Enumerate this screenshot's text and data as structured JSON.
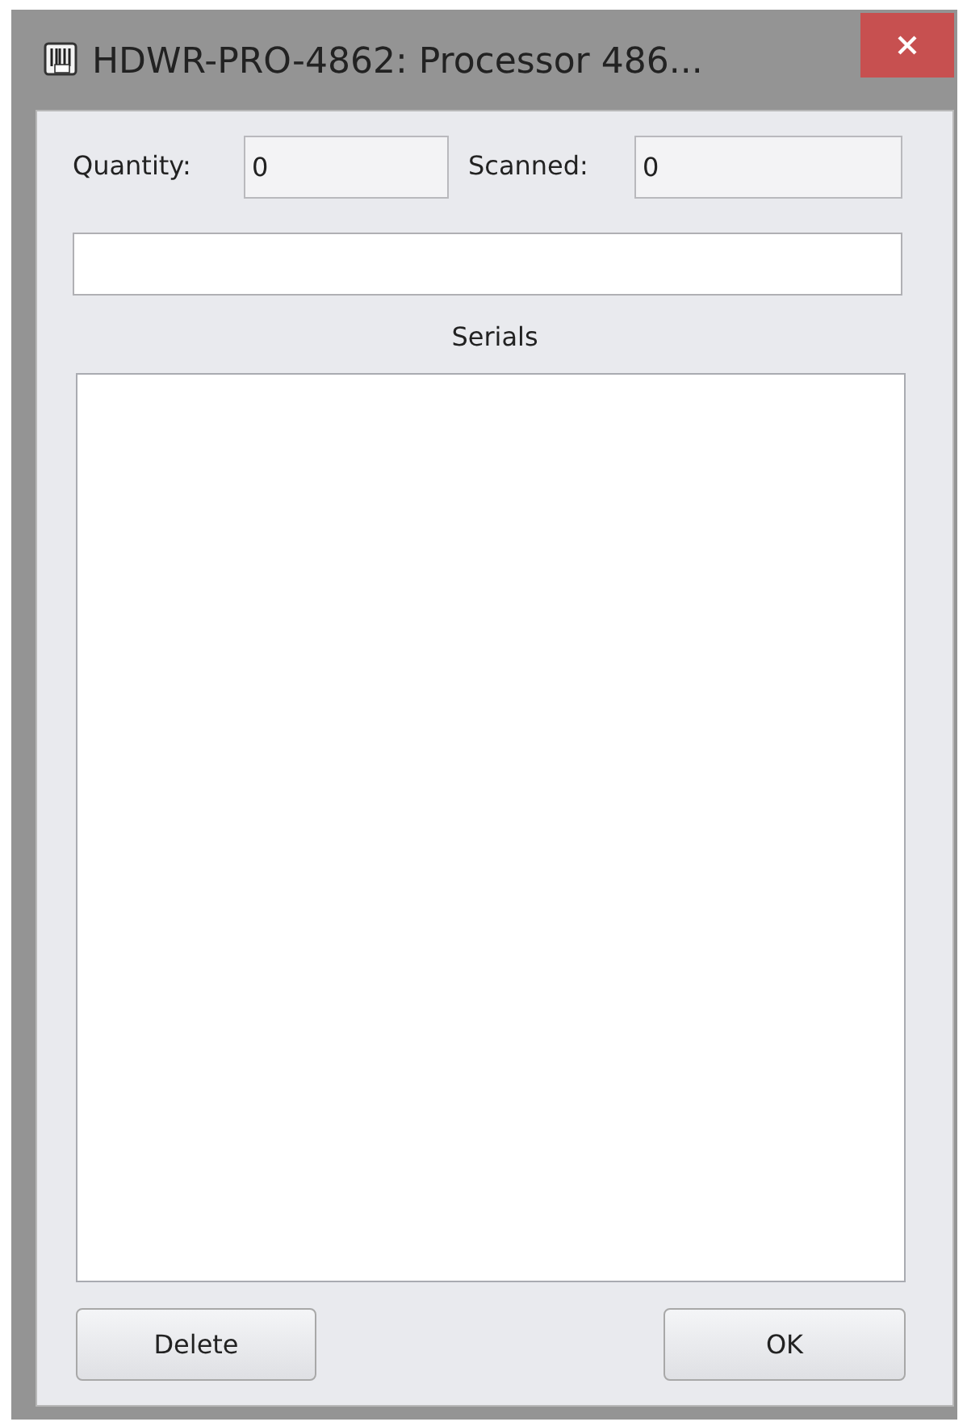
{
  "window": {
    "title": "HDWR-PRO-4862: Processor 486..."
  },
  "quantity": {
    "label": "Quantity:",
    "value": "0"
  },
  "scanned": {
    "label": "Scanned:",
    "value": "0"
  },
  "serials_label": "Serials",
  "buttons": [
    "Delete",
    "OK"
  ]
}
